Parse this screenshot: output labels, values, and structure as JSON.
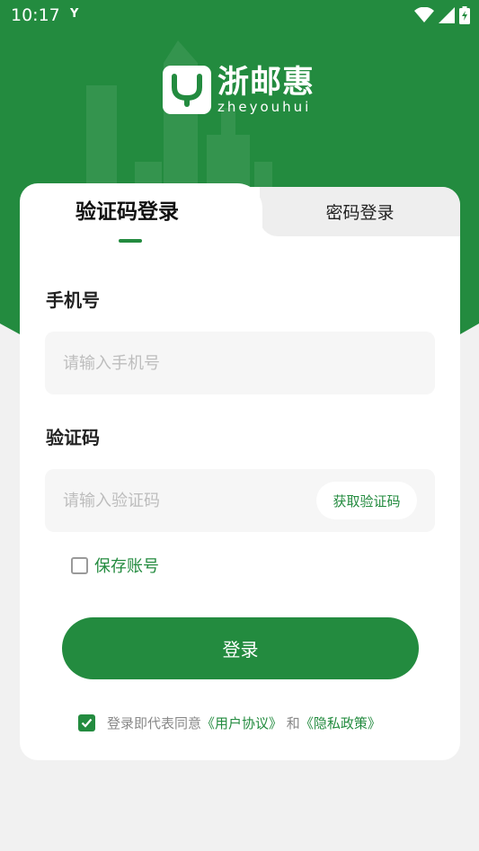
{
  "status_bar": {
    "time": "10:17",
    "notification_glyph": "Y",
    "icons": [
      "wifi-icon",
      "signal-icon",
      "battery-icon"
    ]
  },
  "brand": {
    "name_cn": "浙邮惠",
    "name_en": "zheyouhui"
  },
  "tabs": [
    {
      "label": "验证码登录",
      "active": true
    },
    {
      "label": "密码登录",
      "active": false
    }
  ],
  "form": {
    "phone": {
      "label": "手机号",
      "placeholder": "请输入手机号",
      "value": ""
    },
    "code": {
      "label": "验证码",
      "placeholder": "请输入验证码",
      "value": "",
      "button_label": "获取验证码"
    },
    "remember": {
      "label": "保存账号",
      "checked": false
    }
  },
  "login_button": "登录",
  "agreement": {
    "checked": true,
    "prefix": "登录即代表同意",
    "user_agreement": "《用户协议》",
    "and": " 和",
    "privacy_policy": "《隐私政策》"
  },
  "colors": {
    "primary": "#238b3f",
    "background": "#f1f1f1",
    "input_bg": "#f6f6f6"
  }
}
